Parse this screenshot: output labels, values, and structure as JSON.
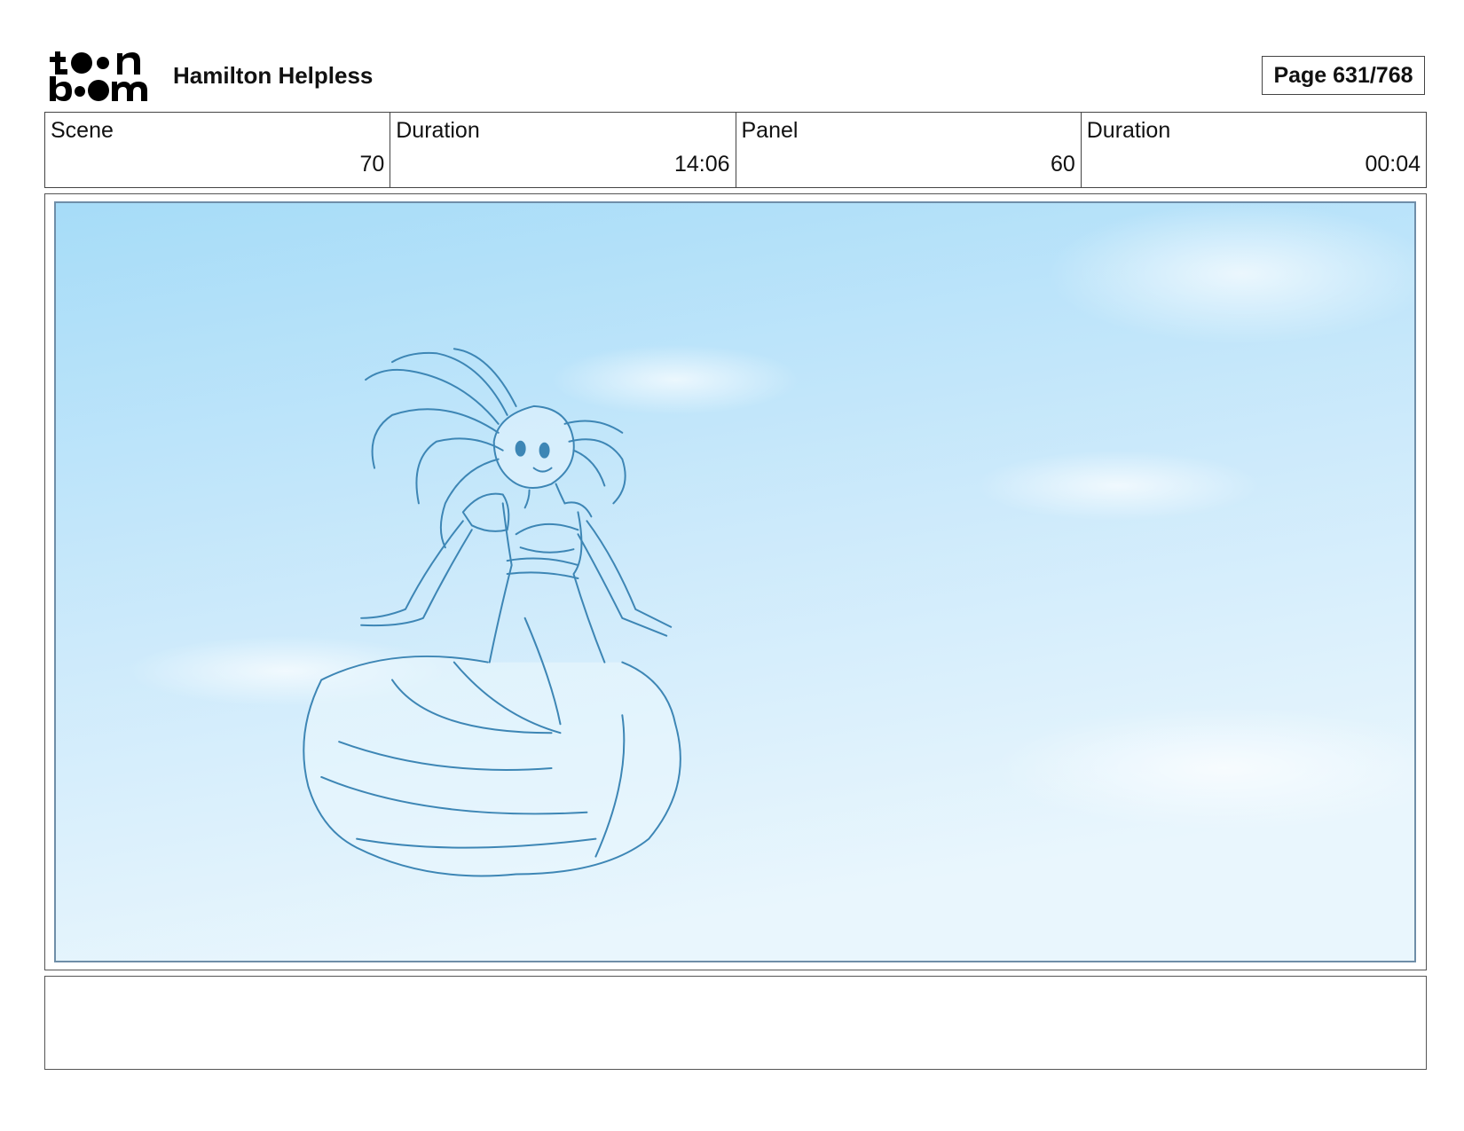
{
  "header": {
    "logo_text_top": "toon",
    "logo_text_bottom": "boom",
    "title": "Hamilton Helpless",
    "page_label": "Page 631/768"
  },
  "info": [
    {
      "label": "Scene",
      "value": "70"
    },
    {
      "label": "Duration",
      "value": "14:06"
    },
    {
      "label": "Panel",
      "value": "60"
    },
    {
      "label": "Duration",
      "value": "00:04"
    }
  ],
  "panel": {
    "icon": "storyboard-sketch-girl-in-sky",
    "sky_color_top": "#a6dcf8",
    "sky_color_bottom": "#e9f6fd",
    "line_color": "#3d86b5"
  },
  "notes": {
    "text": ""
  }
}
